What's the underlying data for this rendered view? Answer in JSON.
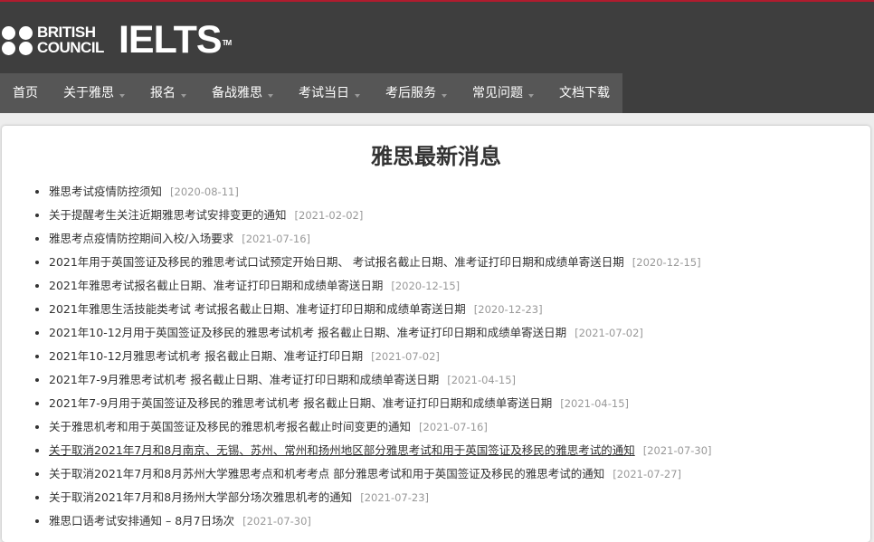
{
  "brand": {
    "british_line1": "BRITISH",
    "british_line2": "COUNCIL",
    "ielts": "IELTS",
    "tm": "TM"
  },
  "nav": {
    "items": [
      {
        "label": "首页"
      },
      {
        "label": "关于雅思"
      },
      {
        "label": "报名"
      },
      {
        "label": "备战雅思"
      },
      {
        "label": "考试当日"
      },
      {
        "label": "考后服务"
      },
      {
        "label": "常见问题"
      },
      {
        "label": "文档下载"
      }
    ]
  },
  "main": {
    "title": "雅思最新消息",
    "news": [
      {
        "title": "雅思考试疫情防控须知",
        "date": "[2020-08-11]"
      },
      {
        "title": "关于提醒考生关注近期雅思考试安排变更的通知",
        "date": "[2021-02-02]"
      },
      {
        "title": "雅思考点疫情防控期间入校/入场要求",
        "date": "[2021-07-16]"
      },
      {
        "title": "2021年用于英国签证及移民的雅思考试口试预定开始日期、 考试报名截止日期、准考证打印日期和成绩单寄送日期",
        "date": "[2020-12-15]"
      },
      {
        "title": "2021年雅思考试报名截止日期、准考证打印日期和成绩单寄送日期",
        "date": "[2020-12-15]"
      },
      {
        "title": "2021年雅思生活技能类考试 考试报名截止日期、准考证打印日期和成绩单寄送日期",
        "date": "[2020-12-23]"
      },
      {
        "title": "2021年10-12月用于英国签证及移民的雅思考试机考 报名截止日期、准考证打印日期和成绩单寄送日期",
        "date": "[2021-07-02]"
      },
      {
        "title": "2021年10-12月雅思考试机考 报名截止日期、准考证打印日期",
        "date": "[2021-07-02]"
      },
      {
        "title": "2021年7-9月雅思考试机考 报名截止日期、准考证打印日期和成绩单寄送日期",
        "date": "[2021-04-15]"
      },
      {
        "title": "2021年7-9月用于英国签证及移民的雅思考试机考 报名截止日期、准考证打印日期和成绩单寄送日期",
        "date": "[2021-04-15]"
      },
      {
        "title": "关于雅思机考和用于英国签证及移民的雅思机考报名截止时间变更的通知",
        "date": "[2021-07-16]"
      },
      {
        "title": "关于取消2021年7月和8月南京、无锡、苏州、常州和扬州地区部分雅思考试和用于英国签证及移民的雅思考试的通知",
        "date": "[2021-07-30]"
      },
      {
        "title": "关于取消2021年7月和8月苏州大学雅思考点和机考考点 部分雅思考试和用于英国签证及移民的雅思考试的通知",
        "date": "[2021-07-27]"
      },
      {
        "title": "关于取消2021年7月和8月扬州大学部分场次雅思机考的通知",
        "date": "[2021-07-23]"
      },
      {
        "title": "雅思口语考试安排通知 – 8月7日场次",
        "date": "[2021-07-30]"
      }
    ]
  }
}
